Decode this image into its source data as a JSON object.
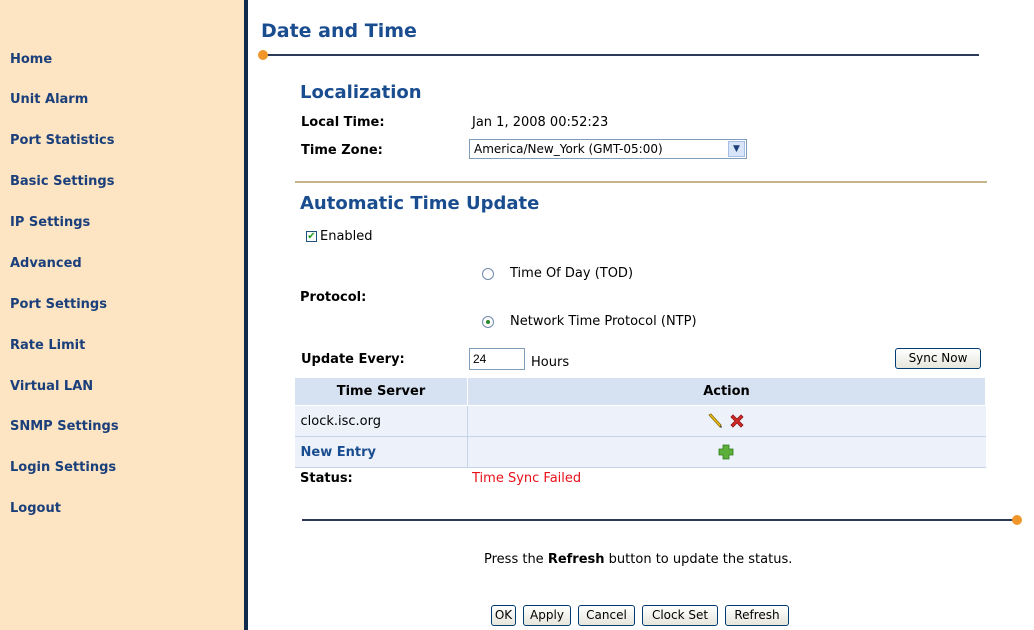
{
  "sidebar": {
    "items": [
      {
        "label": "Home"
      },
      {
        "label": "Unit Alarm"
      },
      {
        "label": "Port Statistics"
      },
      {
        "label": "Basic Settings"
      },
      {
        "label": "IP Settings"
      },
      {
        "label": "Advanced"
      },
      {
        "label": "Port Settings"
      },
      {
        "label": "Rate Limit"
      },
      {
        "label": "Virtual LAN"
      },
      {
        "label": "SNMP Settings"
      },
      {
        "label": "Login Settings"
      },
      {
        "label": "Logout"
      }
    ]
  },
  "page": {
    "title": "Date and Time"
  },
  "localization": {
    "title": "Localization",
    "local_time_label": "Local Time:",
    "local_time_value": "Jan 1, 2008 00:52:23",
    "time_zone_label": "Time Zone:",
    "time_zone_value": "America/New_York (GMT-05:00)"
  },
  "auto_update": {
    "title": "Automatic Time Update",
    "enabled_label": "Enabled",
    "enabled_checked": true,
    "protocol_label": "Protocol:",
    "protocol_options": [
      {
        "label": "Time Of Day (TOD)",
        "selected": false
      },
      {
        "label": "Network Time Protocol (NTP)",
        "selected": true
      }
    ],
    "update_every_label": "Update Every:",
    "update_every_value": "24",
    "update_every_unit": "Hours",
    "sync_now_label": "Sync Now"
  },
  "servers_table": {
    "columns": [
      "Time Server",
      "Action"
    ],
    "rows": [
      {
        "server": "clock.isc.org",
        "actions": [
          "edit-icon",
          "delete-icon"
        ]
      }
    ],
    "new_entry_label": "New Entry",
    "new_entry_action": "add-icon"
  },
  "status": {
    "label": "Status:",
    "value": "Time Sync Failed",
    "value_color": "#e8111a"
  },
  "footer": {
    "hint_prefix": "Press the ",
    "hint_bold": "Refresh",
    "hint_suffix": " button to update the status.",
    "buttons": [
      "OK",
      "Apply",
      "Cancel",
      "Clock Set",
      "Refresh"
    ]
  },
  "colors": {
    "sidebar_bg": "#fde4c2",
    "heading_blue": "#1a4d8f",
    "accent_orange": "#f0962a",
    "table_header_bg": "#d6e1f1"
  }
}
